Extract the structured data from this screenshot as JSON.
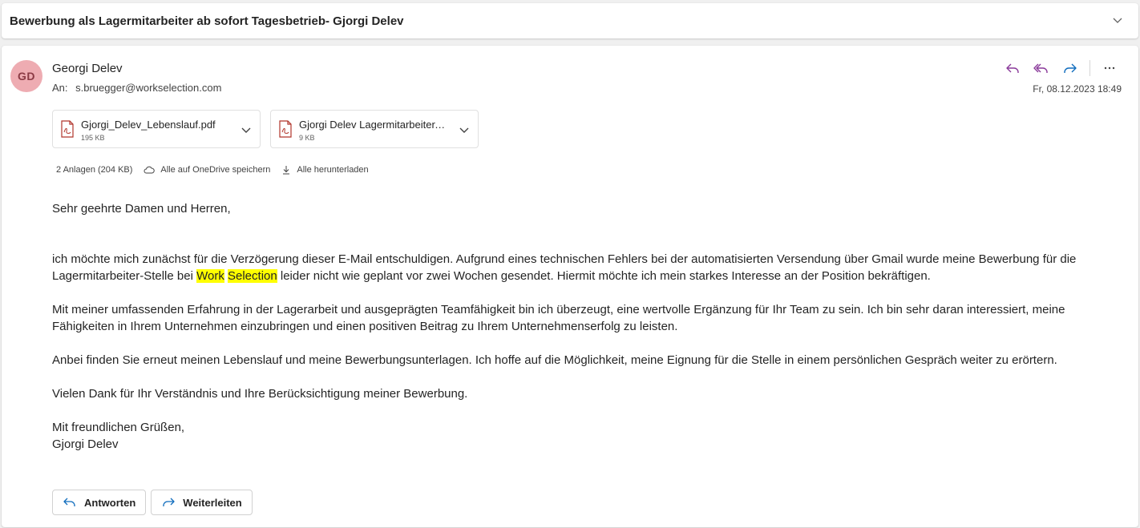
{
  "subject": "Bewerbung als Lagermitarbeiter ab sofort Tagesbetrieb- Gjorgi Delev",
  "message": {
    "avatar_initials": "GD",
    "sender_name": "Georgi Delev",
    "to_label": "An:",
    "to_address": "s.bruegger@workselection.com",
    "date": "Fr, 08.12.2023 18:49",
    "avatar_color": "#eeacb2",
    "action_icon_reply_color": "#8a3a9a",
    "action_icon_forward_color": "#0f6cbd"
  },
  "attachments": [
    {
      "name": "Gjorgi_Delev_Lebenslauf.pdf",
      "size": "195 KB",
      "icon": "pdf-icon"
    },
    {
      "name": "Gjorgi Delev Lagermitarbeiter.pdf",
      "size": "9 KB",
      "icon": "pdf-icon"
    }
  ],
  "attachment_summary": {
    "count_text": "2 Anlagen (204 KB)",
    "onedrive_label": "Alle auf OneDrive speichern",
    "download_label": "Alle herunterladen"
  },
  "body": {
    "greeting": "Sehr geehrte Damen und Herren,",
    "p1_a": "ich möchte mich zunächst für die Verzögerung dieser E-Mail entschuldigen. Aufgrund eines technischen Fehlers bei der automatisierten Versendung über Gmail wurde meine Bewerbung für die Lagermitarbeiter-Stelle bei ",
    "p1_hl1": "Work",
    "p1_hl2": "Selection",
    "p1_b": " leider nicht wie geplant vor zwei Wochen gesendet. Hiermit möchte ich mein starkes Interesse an der Position bekräftigen.",
    "p2": "Mit meiner umfassenden Erfahrung in der Lagerarbeit und ausgeprägten Teamfähigkeit bin ich überzeugt, eine wertvolle Ergänzung für Ihr Team zu sein. Ich bin sehr daran interessiert, meine Fähigkeiten in Ihrem Unternehmen einzubringen und einen positiven Beitrag zu Ihrem Unternehmenserfolg zu leisten.",
    "p3": "Anbei finden Sie erneut meinen Lebenslauf und meine Bewerbungsunterlagen. Ich hoffe auf die Möglichkeit, meine Eignung für die Stelle in einem persönlichen Gespräch weiter zu erörtern.",
    "p4": "Vielen Dank für Ihr Verständnis und Ihre Berücksichtigung meiner Bewerbung.",
    "closing": "Mit freundlichen Grüßen,",
    "signature": "Gjorgi Delev"
  },
  "buttons": {
    "reply_label": "Antworten",
    "forward_label": "Weiterleiten"
  }
}
